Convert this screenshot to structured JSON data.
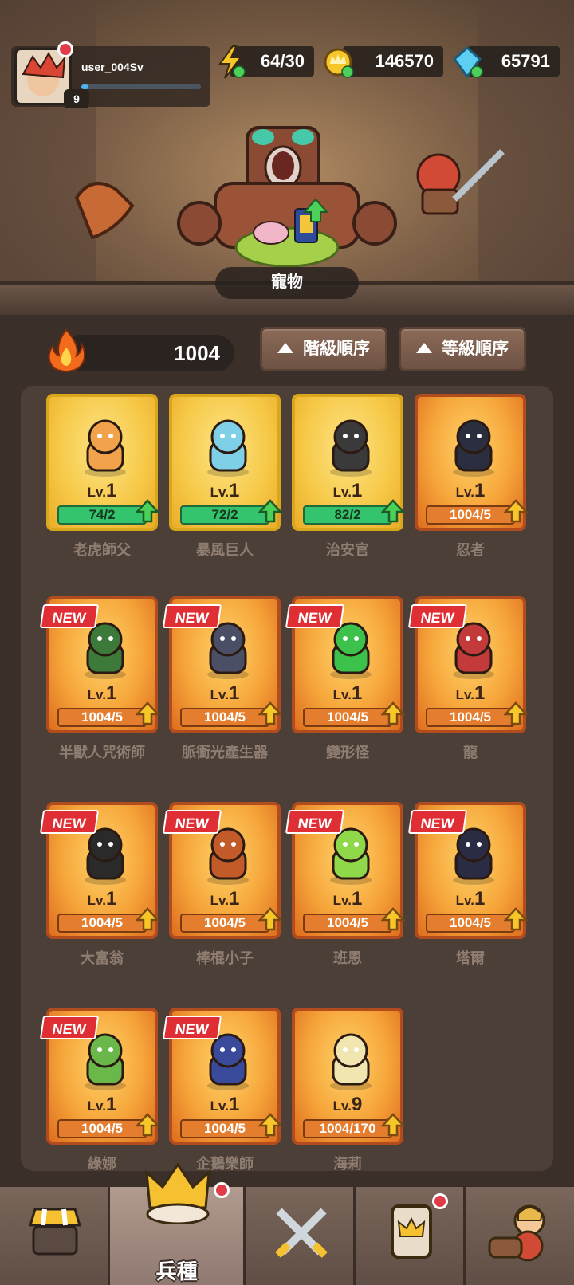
{
  "player": {
    "username": "user_004Sv",
    "level": "9",
    "xp_fraction": 0.06
  },
  "resources": {
    "energy": "64/30",
    "gold": "146570",
    "gems": "65791"
  },
  "scene": {
    "pet_label": "寵物"
  },
  "toolbar": {
    "power": "1004",
    "sort_rank_label": "階級順序",
    "sort_level_label": "等級順序"
  },
  "units": [
    {
      "name": "老虎師父",
      "lv_prefix": "Lv.",
      "lv": "1",
      "progress": "74/2",
      "new": "",
      "style": "yellow"
    },
    {
      "name": "暴風巨人",
      "lv_prefix": "Lv.",
      "lv": "1",
      "progress": "72/2",
      "new": "",
      "style": "yellow"
    },
    {
      "name": "治安官",
      "lv_prefix": "Lv.",
      "lv": "1",
      "progress": "82/2",
      "new": "",
      "style": "yellow"
    },
    {
      "name": "忍者",
      "lv_prefix": "Lv.",
      "lv": "1",
      "progress": "1004/5",
      "new": "",
      "style": "orange"
    },
    {
      "name": "半獸人咒術師",
      "lv_prefix": "Lv.",
      "lv": "1",
      "progress": "1004/5",
      "new": "NEW",
      "style": "orange"
    },
    {
      "name": "脈衝光產生器",
      "lv_prefix": "Lv.",
      "lv": "1",
      "progress": "1004/5",
      "new": "NEW",
      "style": "orange"
    },
    {
      "name": "變形怪",
      "lv_prefix": "Lv.",
      "lv": "1",
      "progress": "1004/5",
      "new": "NEW",
      "style": "orange"
    },
    {
      "name": "龍",
      "lv_prefix": "Lv.",
      "lv": "1",
      "progress": "1004/5",
      "new": "NEW",
      "style": "orange"
    },
    {
      "name": "大富翁",
      "lv_prefix": "Lv.",
      "lv": "1",
      "progress": "1004/5",
      "new": "NEW",
      "style": "orange"
    },
    {
      "name": "棒棍小子",
      "lv_prefix": "Lv.",
      "lv": "1",
      "progress": "1004/5",
      "new": "NEW",
      "style": "orange"
    },
    {
      "name": "班恩",
      "lv_prefix": "Lv.",
      "lv": "1",
      "progress": "1004/5",
      "new": "NEW",
      "style": "orange"
    },
    {
      "name": "塔爾",
      "lv_prefix": "Lv.",
      "lv": "1",
      "progress": "1004/5",
      "new": "NEW",
      "style": "orange"
    },
    {
      "name": "綠娜",
      "lv_prefix": "Lv.",
      "lv": "1",
      "progress": "1004/5",
      "new": "NEW",
      "style": "orange"
    },
    {
      "name": "企鵝樂師",
      "lv_prefix": "Lv.",
      "lv": "1",
      "progress": "1004/5",
      "new": "NEW",
      "style": "orange"
    },
    {
      "name": "海莉",
      "lv_prefix": "Lv.",
      "lv": "9",
      "progress": "1004/170",
      "new": "",
      "style": "orange"
    }
  ],
  "nav": {
    "active_label": "兵種"
  },
  "colors": {
    "green_progress": "#35c46e",
    "orange_progress": "#e47e2e",
    "new_badge": "#e02e35",
    "notification_dot": "#e23c4a"
  }
}
